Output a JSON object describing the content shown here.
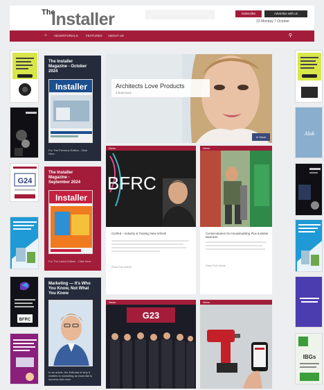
{
  "header": {
    "logo_the": "The",
    "logo_main": "Installer",
    "subscribe": "Subscribe",
    "advertise": "Advertise with us",
    "date": "23 Monday 7 October"
  },
  "nav": {
    "home_icon": "home-icon",
    "items": [
      "ADVERTORIALS",
      "FEATURES",
      "ABOUT US"
    ],
    "search_icon": "search-icon"
  },
  "magazines": [
    {
      "title": "The Installer Magazine - October 2024",
      "cover_title": "Installer",
      "footer": "For The Previous Edition - Click Here"
    },
    {
      "title": "The Installer Magazine - September 2024",
      "cover_title": "Installer",
      "footer": "For The Latest Edition - Click Here"
    },
    {
      "title": "Marketing — It's Who You Know, Not What You Know",
      "footer": "In an article, the Editorial of why it matters to marketing as essential to success and more"
    }
  ],
  "hero": {
    "title": "Architects Love Products",
    "subtitle": "& Build more",
    "badge": "In Stock"
  },
  "cards": [
    {
      "tag": "News",
      "image_text": "BFRC",
      "title": "Certfed – Industry & Training New refresh"
    },
    {
      "tag": "News",
      "title": "Conservatories Go Housebuilding Plus & Better Business"
    },
    {
      "tag": "News",
      "image_text": "G23"
    },
    {
      "tag": "News"
    }
  ],
  "side_ads": {
    "left": [
      {
        "name": "ad-left-1",
        "text": "THE LATEST DEALS"
      },
      {
        "name": "ad-left-2",
        "text": "PURPLOS"
      },
      {
        "name": "ad-left-3",
        "text": "G24"
      },
      {
        "name": "ad-left-4",
        "text": "Industry leading"
      },
      {
        "name": "ad-left-5",
        "text": "BFRC"
      },
      {
        "name": "ad-left-6",
        "text": "Quality"
      }
    ],
    "right": [
      {
        "name": "ad-right-1",
        "text": "THE LATEST INNOVATIONS"
      },
      {
        "name": "ad-right-2",
        "text": "Aluk"
      },
      {
        "name": "ad-right-3",
        "text": "PURPLOS"
      },
      {
        "name": "ad-right-4",
        "text": "Industry leading"
      },
      {
        "name": "ad-right-5",
        "text": "Education"
      },
      {
        "name": "ad-right-6",
        "text": "IBGs"
      }
    ]
  },
  "colors": {
    "brand": "#a31d3b",
    "navy": "#252b3b"
  },
  "more_label": "Read Full Article"
}
